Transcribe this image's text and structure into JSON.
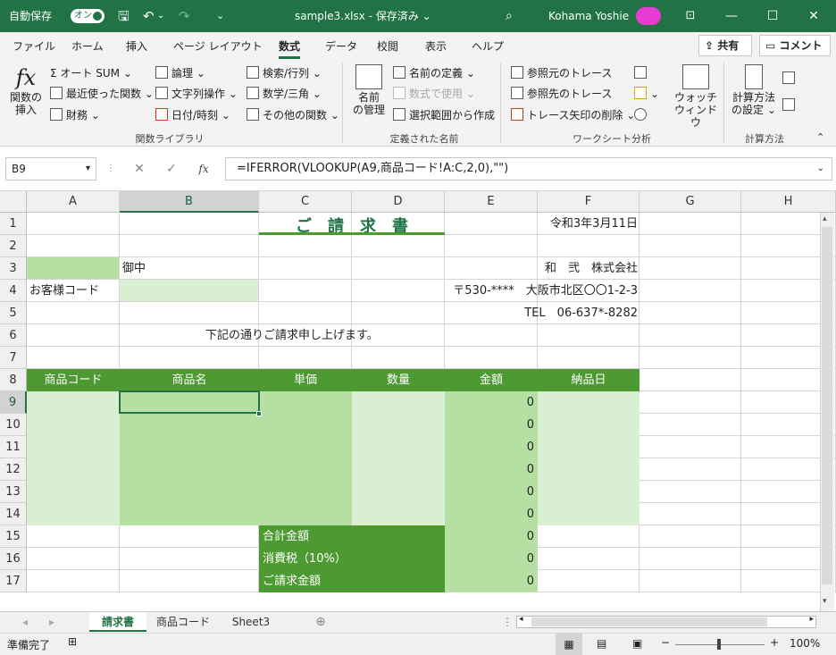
{
  "titlebar": {
    "autosave_label": "自動保存",
    "autosave_state": "オン",
    "filename": "sample3.xlsx",
    "save_status": "保存済み",
    "user": "Kohama Yoshie"
  },
  "ribbon_tabs": [
    "ファイル",
    "ホーム",
    "挿入",
    "ページ レイアウト",
    "数式",
    "データ",
    "校閲",
    "表示",
    "ヘルプ"
  ],
  "active_tab": "数式",
  "share_label": "共有",
  "comment_label": "コメント",
  "ribbon": {
    "insert_function": [
      "関数の",
      "挿入"
    ],
    "autosum": "オート SUM",
    "recent": "最近使った関数",
    "financial": "財務",
    "logical": "論理",
    "text": "文字列操作",
    "datetime": "日付/時刻",
    "lookup": "検索/行列",
    "math": "数学/三角",
    "more": "その他の関数",
    "group_library": "関数ライブラリ",
    "name_manager": [
      "名前",
      "の管理"
    ],
    "define_name": "名前の定義",
    "use_in_formula": "数式で使用",
    "create_from_selection": "選択範囲から作成",
    "group_names": "定義された名前",
    "trace_precedents": "参照元のトレース",
    "trace_dependents": "参照先のトレース",
    "remove_arrows": "トレース矢印の削除",
    "watch_window": [
      "ウォッチ",
      "ウィンドウ"
    ],
    "group_audit": "ワークシート分析",
    "calc_options": [
      "計算方法",
      "の設定"
    ],
    "group_calc": "計算方法"
  },
  "formula_bar": {
    "name_box": "B9",
    "formula": "=IFERROR(VLOOKUP(A9,商品コード!A:C,2,0),\"\")"
  },
  "columns": [
    "A",
    "B",
    "C",
    "D",
    "E",
    "F",
    "G",
    "H"
  ],
  "rows": [
    "1",
    "2",
    "3",
    "4",
    "5",
    "6",
    "7",
    "8",
    "9",
    "10",
    "11",
    "12",
    "13",
    "14",
    "15",
    "16",
    "17"
  ],
  "sheet": {
    "title": "ご　請　求　書",
    "date": "令和3年3月11日",
    "onchu": "御中",
    "company": "和　弐　株式会社",
    "customer_code_label": "お客様コード",
    "address": "〒530-****　大阪市北区〇〇1-2-3",
    "tel": "TEL　06-637*-8282",
    "message": "下記の通りご請求申し上げます。",
    "headers": [
      "商品コード",
      "商品名",
      "単価",
      "数量",
      "金額",
      "納品日"
    ],
    "amounts": [
      "0",
      "0",
      "0",
      "0",
      "0",
      "0"
    ],
    "total_label": "合計金額",
    "tax_label": "消費税（10%）",
    "grand_label": "ご請求金額",
    "total_values": [
      "0",
      "0",
      "0"
    ]
  },
  "sheet_tabs": [
    "請求書",
    "商品コード",
    "Sheet3"
  ],
  "status": {
    "ready": "準備完了",
    "zoom": "100%"
  },
  "colors": {
    "excel_green": "#217346",
    "header_green": "#4e9a32",
    "light_green": "#d9efd2",
    "mid_green": "#b6dfa4",
    "dark_green": "#4e9a32"
  }
}
